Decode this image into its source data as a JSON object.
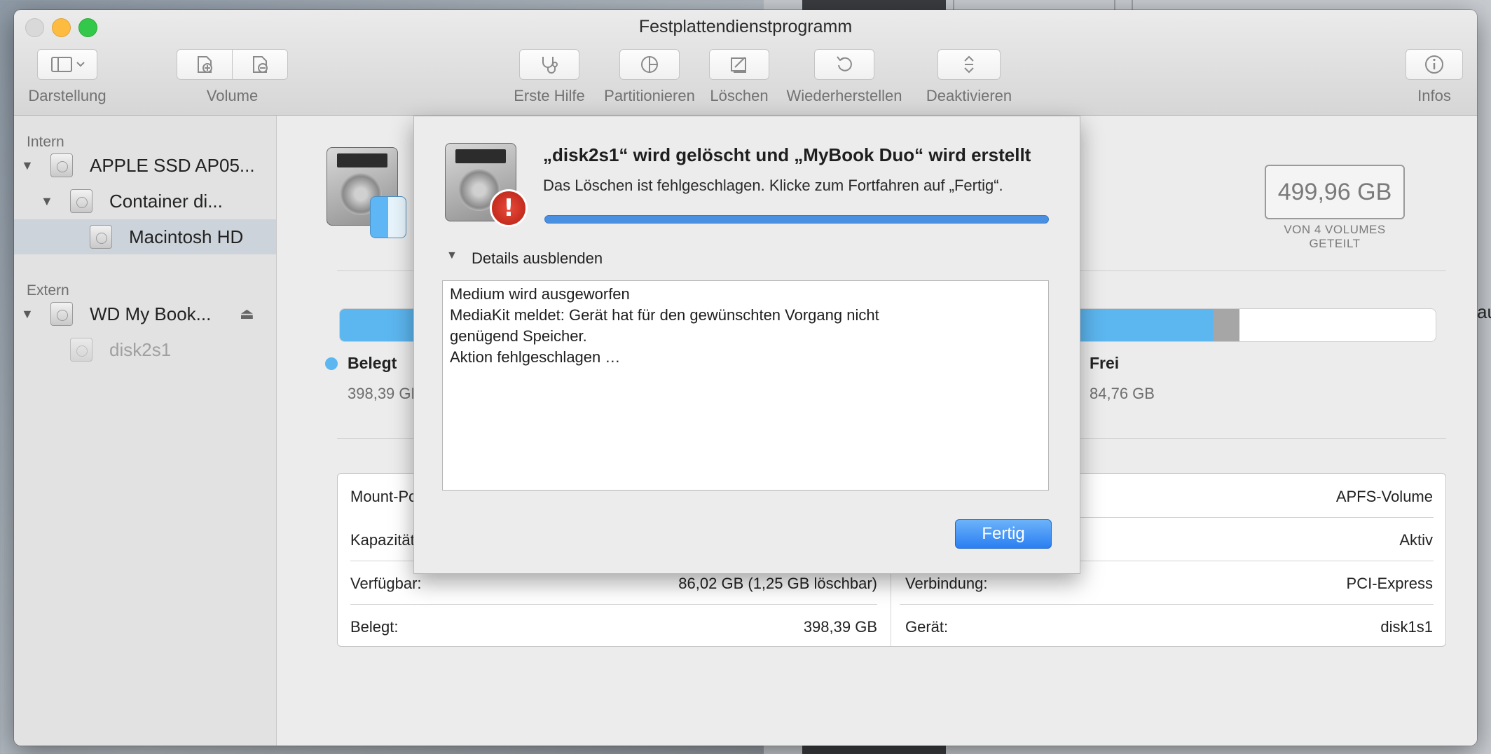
{
  "window": {
    "title": "Festplattendienstprogramm"
  },
  "toolbar": {
    "darstellung": "Darstellung",
    "volume": "Volume",
    "erste_hilfe": "Erste Hilfe",
    "partitionieren": "Partitionieren",
    "loeschen": "Löschen",
    "wiederherstellen": "Wiederherstellen",
    "deaktivieren": "Deaktivieren",
    "infos": "Infos"
  },
  "sidebar": {
    "intern_header": "Intern",
    "extern_header": "Extern",
    "items": [
      {
        "label": "APPLE SSD AP05..."
      },
      {
        "label": "Container di..."
      },
      {
        "label": "Macintosh HD"
      },
      {
        "label": "WD My Book..."
      },
      {
        "label": "disk2s1"
      }
    ]
  },
  "volume": {
    "capacity": "499,96 GB",
    "capacity_sub": "VON 4 VOLUMES GETEILT",
    "used_label": "Belegt",
    "used_value": "398,39 GB",
    "free_label": "Frei",
    "free_value": "84,76 GB",
    "used_fraction": 0.797,
    "other_fraction": 0.024,
    "used_color": "#5cb6ef",
    "other_color": "#a6a6a6"
  },
  "info": {
    "left": [
      {
        "label": "Mount-Poi",
        "value": ""
      },
      {
        "label": "Kapazität:",
        "value": ""
      },
      {
        "label": "Verfügbar:",
        "value": "86,02 GB (1,25 GB löschbar)"
      },
      {
        "label": "Belegt:",
        "value": "398,39 GB"
      }
    ],
    "right": [
      {
        "label": "",
        "value": "APFS-Volume"
      },
      {
        "label": "",
        "value": "Aktiv"
      },
      {
        "label": "Verbindung:",
        "value": "PCI-Express"
      },
      {
        "label": "Gerät:",
        "value": "disk1s1"
      }
    ]
  },
  "sheet": {
    "title": "„disk2s1“ wird gelöscht und „MyBook Duo“ wird erstellt",
    "message": "Das Löschen ist fehlgeschlagen. Klicke zum Fortfahren auf „Fertig“.",
    "progress": 1.0,
    "details_toggle": "Details ausblenden",
    "log": [
      "Medium wird ausgeworfen",
      "MediaKit meldet: Gerät hat für den gewünschten Vorgang nicht genügend Speicher.",
      "Aktion fehlgeschlagen …"
    ],
    "done_button": "Fertig",
    "accent": "#2a7ff2",
    "error_color": "#c8281a"
  }
}
